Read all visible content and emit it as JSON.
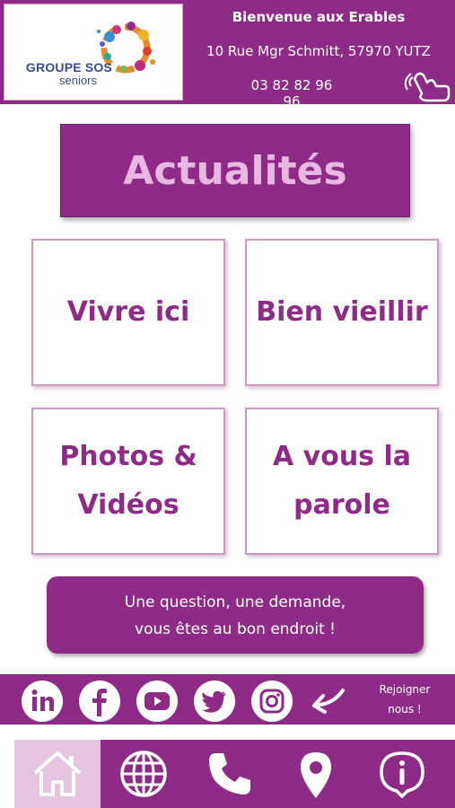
{
  "header": {
    "logo": {
      "main": "GROUPE SOS",
      "sub": "seniors"
    },
    "welcome": "Bienvenue aux Erables",
    "address": "10 Rue Mgr Schmitt, 57970 YUTZ",
    "phone": "03 82 82 96 96",
    "icons": [
      "tap-hand-icon"
    ]
  },
  "main": {
    "news_title": "Actualités",
    "tiles": [
      {
        "line1": "Vivre ici",
        "line2": ""
      },
      {
        "line1": "Bien vieillir",
        "line2": ""
      },
      {
        "line1": "Photos &",
        "line2": "Vidéos"
      },
      {
        "line1": "A vous la",
        "line2": "parole"
      }
    ],
    "question": {
      "line1": "Une question, une demande,",
      "line2": "vous êtes au bon endroit !"
    }
  },
  "social": {
    "icons": [
      "linkedin-icon",
      "facebook-icon",
      "youtube-icon",
      "twitter-icon",
      "instagram-icon",
      "arrow-icon"
    ],
    "join_line1": "Rejoigner",
    "join_line2": "nous !"
  },
  "nav": {
    "items": [
      "home-icon",
      "globe-icon",
      "phone-icon",
      "location-pin-icon",
      "info-icon"
    ],
    "active_index": 0
  },
  "colors": {
    "brand_purple": "#8e2b86",
    "title_pink": "#e7b8e2",
    "active_nav": "#e4c4e0",
    "tile_border": "#c79cc2"
  }
}
